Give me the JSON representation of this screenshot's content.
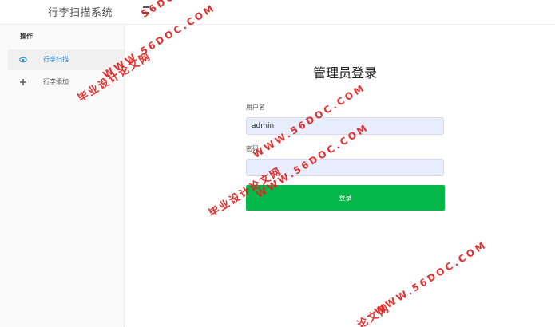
{
  "app": {
    "title": "行李扫描系统"
  },
  "sidebar": {
    "heading": "操作",
    "items": [
      {
        "label": "行李扫描",
        "icon": "eye-icon",
        "active": true
      },
      {
        "label": "行李添加",
        "icon": "plus-icon",
        "active": false
      }
    ]
  },
  "login": {
    "title": "管理员登录",
    "username_label": "用户名",
    "username_value": "admin",
    "password_label": "密码",
    "password_value": "",
    "submit_label": "登录"
  },
  "watermarks": {
    "site_cn": "毕业设计论文网",
    "site_url": "WWW.56DOC.COM",
    "site_cn_partial": "论文网",
    "site_url_partial": "56DOC.C"
  },
  "colors": {
    "accent": "#2a8ed9",
    "button": "#05b84a",
    "input_bg": "#e8eefe",
    "watermark": "#e02020"
  }
}
